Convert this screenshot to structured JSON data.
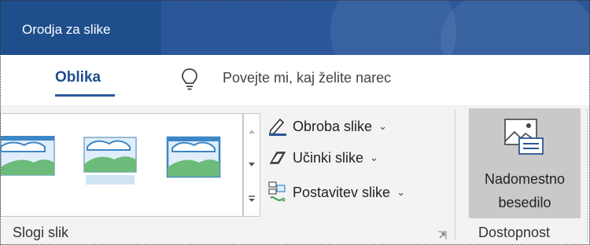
{
  "context_bar": {
    "label": "Orodja za slike"
  },
  "tabs": {
    "active_tab": "Oblika"
  },
  "tell_me": {
    "icon": "lightbulb-icon",
    "placeholder": "Povejte mi, kaj želite narec"
  },
  "picture_styles": {
    "group_label": "Slogi slik",
    "thumbnails": [
      "picture-style-1",
      "picture-style-2",
      "picture-style-3"
    ],
    "commands": [
      {
        "label": "Obroba slike",
        "icon": "picture-border-icon"
      },
      {
        "label": "Učinki slike",
        "icon": "picture-effects-icon"
      },
      {
        "label": "Postavitev slike",
        "icon": "picture-layout-icon"
      }
    ]
  },
  "accessibility": {
    "group_label": "Dostopnost",
    "alt_text_line1": "Nadomestno",
    "alt_text_line2": "besedilo"
  },
  "colors": {
    "accent": "#2b579a",
    "context_tab": "#1e4e8c"
  }
}
